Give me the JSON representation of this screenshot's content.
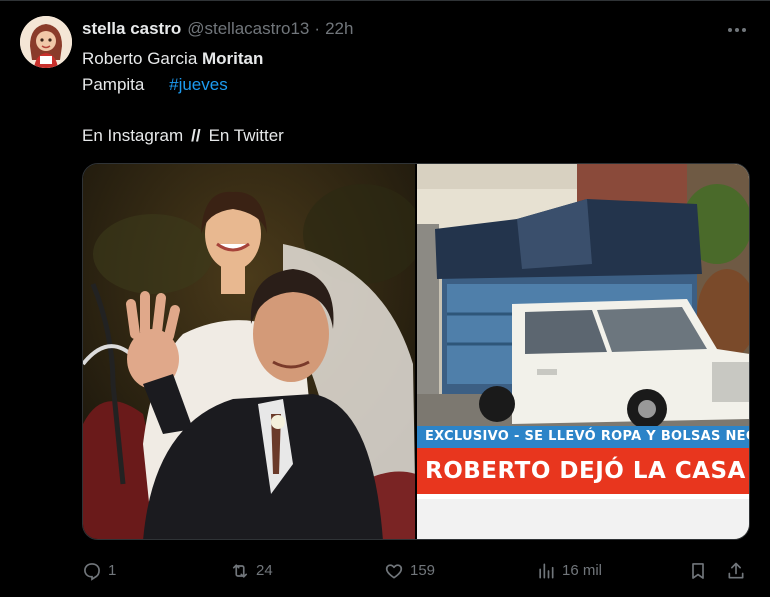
{
  "user": {
    "name": "stella castro",
    "handle": "@stellacastro13",
    "separator": "·",
    "time": "22h"
  },
  "tweet": {
    "line1_regular": "Roberto Garcia",
    "line1_bold": "Moritan",
    "line2_text": "Pampita",
    "hashtag": "#jueves",
    "line3_left": "En Instagram",
    "line3_sep": "//",
    "line3_right": "En Twitter"
  },
  "media": {
    "banner_small": "EXCLUSIVO - SE LLEVÓ ROPA Y BOLSAS NEGRAS",
    "banner_large": "ROBERTO DEJÓ LA CASA AL ME"
  },
  "actions": {
    "replies": "1",
    "retweets": "24",
    "likes": "159",
    "views": "16 mil"
  },
  "colors": {
    "background": "#000000",
    "text": "#e7e9ea",
    "muted": "#71767b",
    "link": "#1d9bf0",
    "banner_blue": "#2c84c8",
    "banner_red": "#e8361e"
  },
  "icons": [
    "more-icon",
    "reply-icon",
    "retweet-icon",
    "like-icon",
    "views-icon",
    "bookmark-icon",
    "share-icon"
  ]
}
